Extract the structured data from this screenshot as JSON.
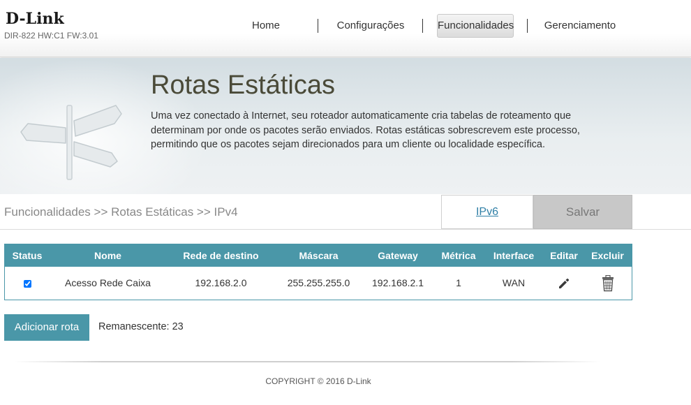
{
  "header": {
    "logo": "D-Link",
    "model": "DIR-822 HW:C1 FW:3.01",
    "nav": [
      {
        "label": "Home"
      },
      {
        "label": "Configurações"
      },
      {
        "label": "Funcionalidades",
        "active": true
      },
      {
        "label": "Gerenciamento"
      }
    ]
  },
  "banner": {
    "title": "Rotas Estáticas",
    "description": "Uma vez conectado à Internet, seu roteador automaticamente cria tabelas de roteamento que determinam por onde os pacotes serão enviados. Rotas estáticas sobrescrevem este processo, permitindo que os pacotes sejam direcionados para um cliente ou localidade específica."
  },
  "breadcrumb": "Funcionalidades >> Rotas Estáticas >> IPv4",
  "ipv6_link": "IPv6",
  "save_label": "Salvar",
  "table": {
    "headers": [
      "Status",
      "Nome",
      "Rede de destino",
      "Máscara",
      "Gateway",
      "Métrica",
      "Interface",
      "Editar",
      "Excluir"
    ],
    "rows": [
      {
        "status_checked": true,
        "nome": "Acesso Rede Caixa",
        "rede_destino": "192.168.2.0",
        "mascara": "255.255.255.0",
        "gateway": "192.168.2.1",
        "metrica": "1",
        "interface": "WAN",
        "edit_icon": "pencil-icon",
        "delete_icon": "trash-icon"
      }
    ]
  },
  "add_route_label": "Adicionar rota",
  "remaining_label": "Remanescente:",
  "remaining_count": "23",
  "footer": {
    "copyright": "COPYRIGHT © 2016 D-Link"
  },
  "colors": {
    "accent": "#4a97a8",
    "save_bg": "#c8c8c8",
    "link": "#2f7fa6"
  }
}
